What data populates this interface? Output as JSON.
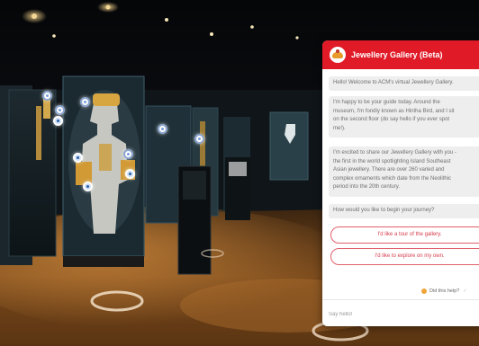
{
  "chat": {
    "title": "Jewellery Gallery (Beta)",
    "messages": {
      "welcome": "Hello! Welcome to ACM's virtual Jewellery Gallery.",
      "intro_lines": [
        "I'm happy to be your guide today. Around the",
        "museum, I'm fondly known as Hintha Bird, and I sit",
        "on the second floor (do say hello if you ever spot",
        "me!)."
      ],
      "share_lines": [
        "I'm excited to share our Jewellery Gallery with you -",
        "the first in the world spotlighting Island Southeast",
        "Asian jewellery. There are over 260 varied and",
        "complex ornaments which date from the Neolithic",
        "period into the 20th century."
      ],
      "question": "How would you like to begin your journey?"
    },
    "options": [
      "I'd like a tour of the gallery.",
      "I'd like to explore on my own."
    ],
    "help_label": "Did this help?",
    "input": {
      "placeholder": "Say hello!"
    }
  }
}
